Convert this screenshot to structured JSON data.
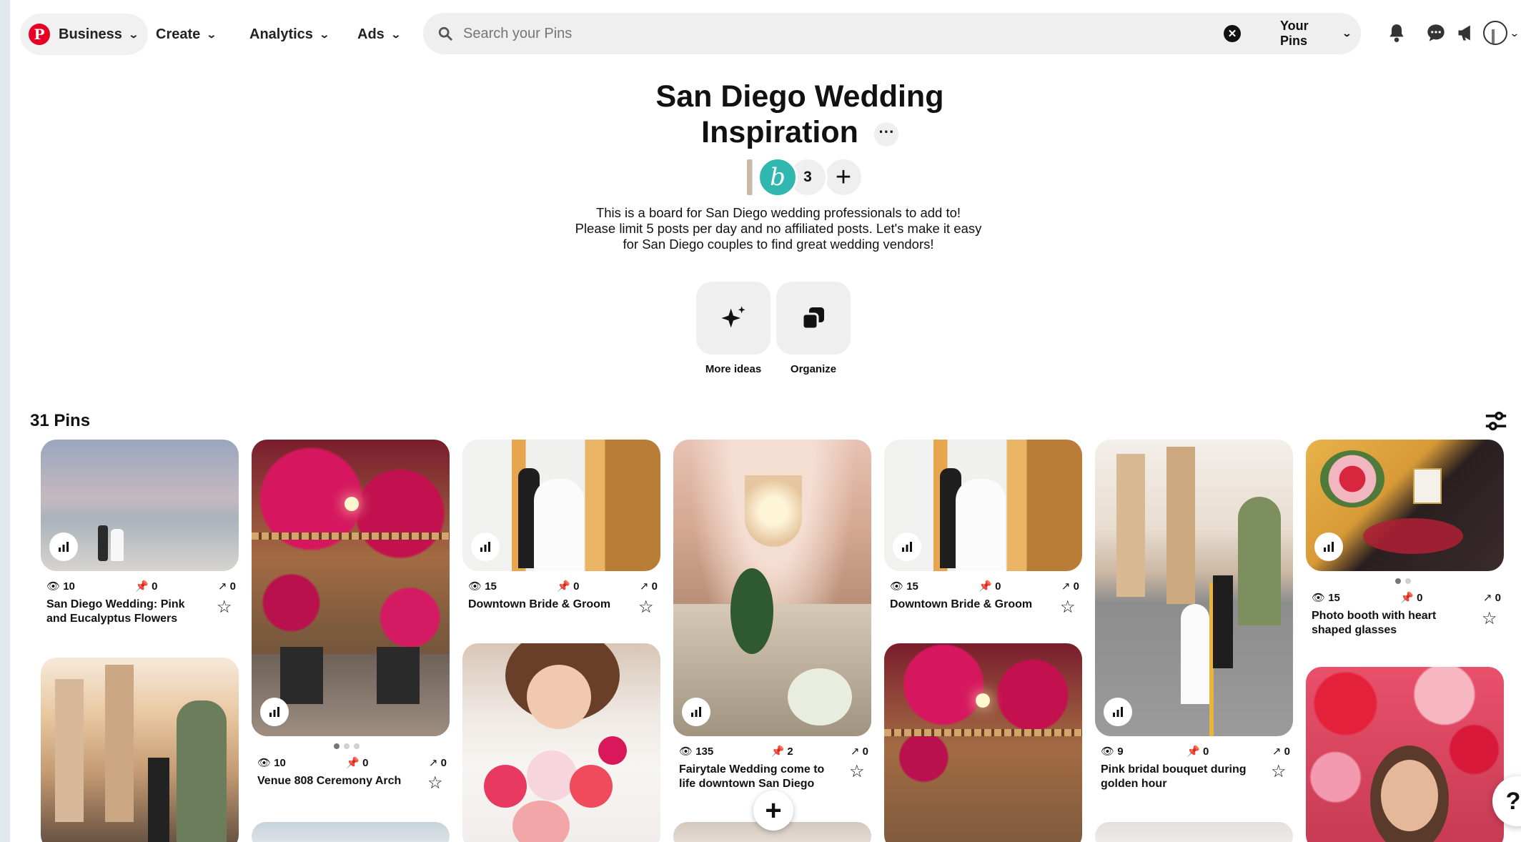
{
  "nav": {
    "business_label": "Business",
    "create_label": "Create",
    "analytics_label": "Analytics",
    "ads_label": "Ads",
    "search_placeholder": "Search your Pins",
    "your_pins_label": "Your Pins",
    "logo_glyph": "P",
    "icons": [
      "bell-icon",
      "messages-icon",
      "megaphone-icon",
      "profile-avatar",
      "account-chevron-icon"
    ]
  },
  "board": {
    "title": "San Diego Wedding Inspiration",
    "collaborator_count": "3",
    "description": "This is a board for San Diego wedding professionals to add to! Please limit 5 posts per day and no affiliated posts. Let's make it easy for San Diego couples to find great wedding vendors!",
    "more_ideas_label": "More ideas",
    "organize_label": "Organize",
    "pins_count_label": "31 Pins"
  },
  "pins": [
    {
      "views": "10",
      "saves": "0",
      "clicks": "0",
      "title": "San Diego Wedding: Pink and Eucalyptus Flowers"
    },
    {
      "views": "10",
      "saves": "0",
      "clicks": "0",
      "title": "Venue 808 Ceremony Arch"
    },
    {
      "views": "15",
      "saves": "0",
      "clicks": "0",
      "title": "Downtown Bride & Groom"
    },
    {
      "views": "135",
      "saves": "2",
      "clicks": "0",
      "title": "Fairytale Wedding come to life downtown San Diego"
    },
    {
      "views": "15",
      "saves": "0",
      "clicks": "0",
      "title": "Downtown Bride & Groom"
    },
    {
      "views": "9",
      "saves": "0",
      "clicks": "0",
      "title": "Pink bridal bouquet during golden hour"
    },
    {
      "views": "15",
      "saves": "0",
      "clicks": "0",
      "title": "Photo booth with heart shaped glasses"
    }
  ],
  "help_label": "?",
  "add_label": "+"
}
